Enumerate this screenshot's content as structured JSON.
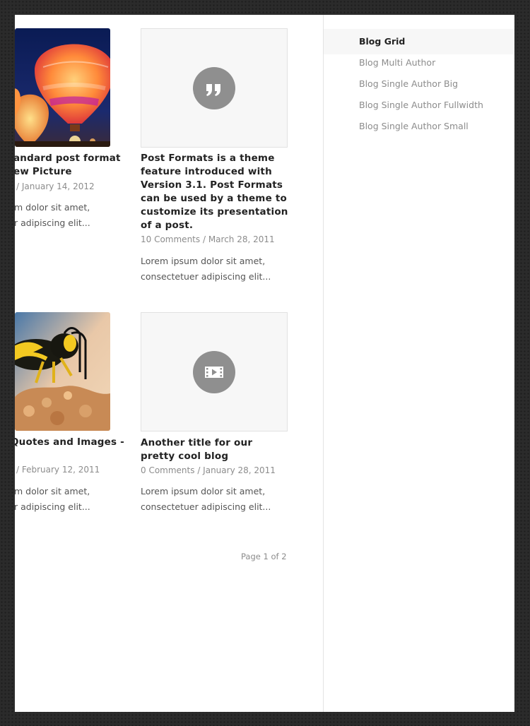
{
  "posts": [
    {
      "title_line1": "andard post format",
      "title_line2": "ew Picture",
      "meta_date": "/ January 14, 2012",
      "excerpt_line1": "m dolor sit amet,",
      "excerpt_line2": "r adipiscing elit..."
    },
    {
      "title": "Post Formats is a theme feature introduced with Version 3.1. Post Formats can be used by a theme to customize its presentation of a post.",
      "meta_comments": "10 Comments",
      "meta_sep": " / ",
      "meta_date": "March 28, 2011",
      "excerpt": "Lorem ipsum dolor sit amet, consectetuer adipiscing elit..."
    },
    {
      "title_line1": "Quotes and Images -",
      "meta_date": "/ February 12, 2011",
      "excerpt_line1": "m dolor sit amet,",
      "excerpt_line2": "r adipiscing elit..."
    },
    {
      "title": "Another title for our pretty cool blog",
      "meta_comments": "0 Comments",
      "meta_sep": " / ",
      "meta_date": "January 28, 2011",
      "excerpt": "Lorem ipsum dolor sit amet, consectetuer adipiscing elit..."
    }
  ],
  "pagination": {
    "label": "Page 1 of 2"
  },
  "sidebar": {
    "items": [
      {
        "label": "Blog Grid",
        "active": true
      },
      {
        "label": "Blog Multi Author",
        "active": false
      },
      {
        "label": "Blog Single Author Big",
        "active": false
      },
      {
        "label": "Blog Single Author Fullwidth",
        "active": false
      },
      {
        "label": "Blog Single Author Small",
        "active": false
      }
    ]
  },
  "icons": {
    "quote_format": "quote-icon",
    "video_format": "video-film-icon"
  },
  "colors": {
    "background": "#2b2b2b",
    "format_circle": "#8f8f8f",
    "title": "#222222",
    "meta": "#8c8c8c"
  }
}
